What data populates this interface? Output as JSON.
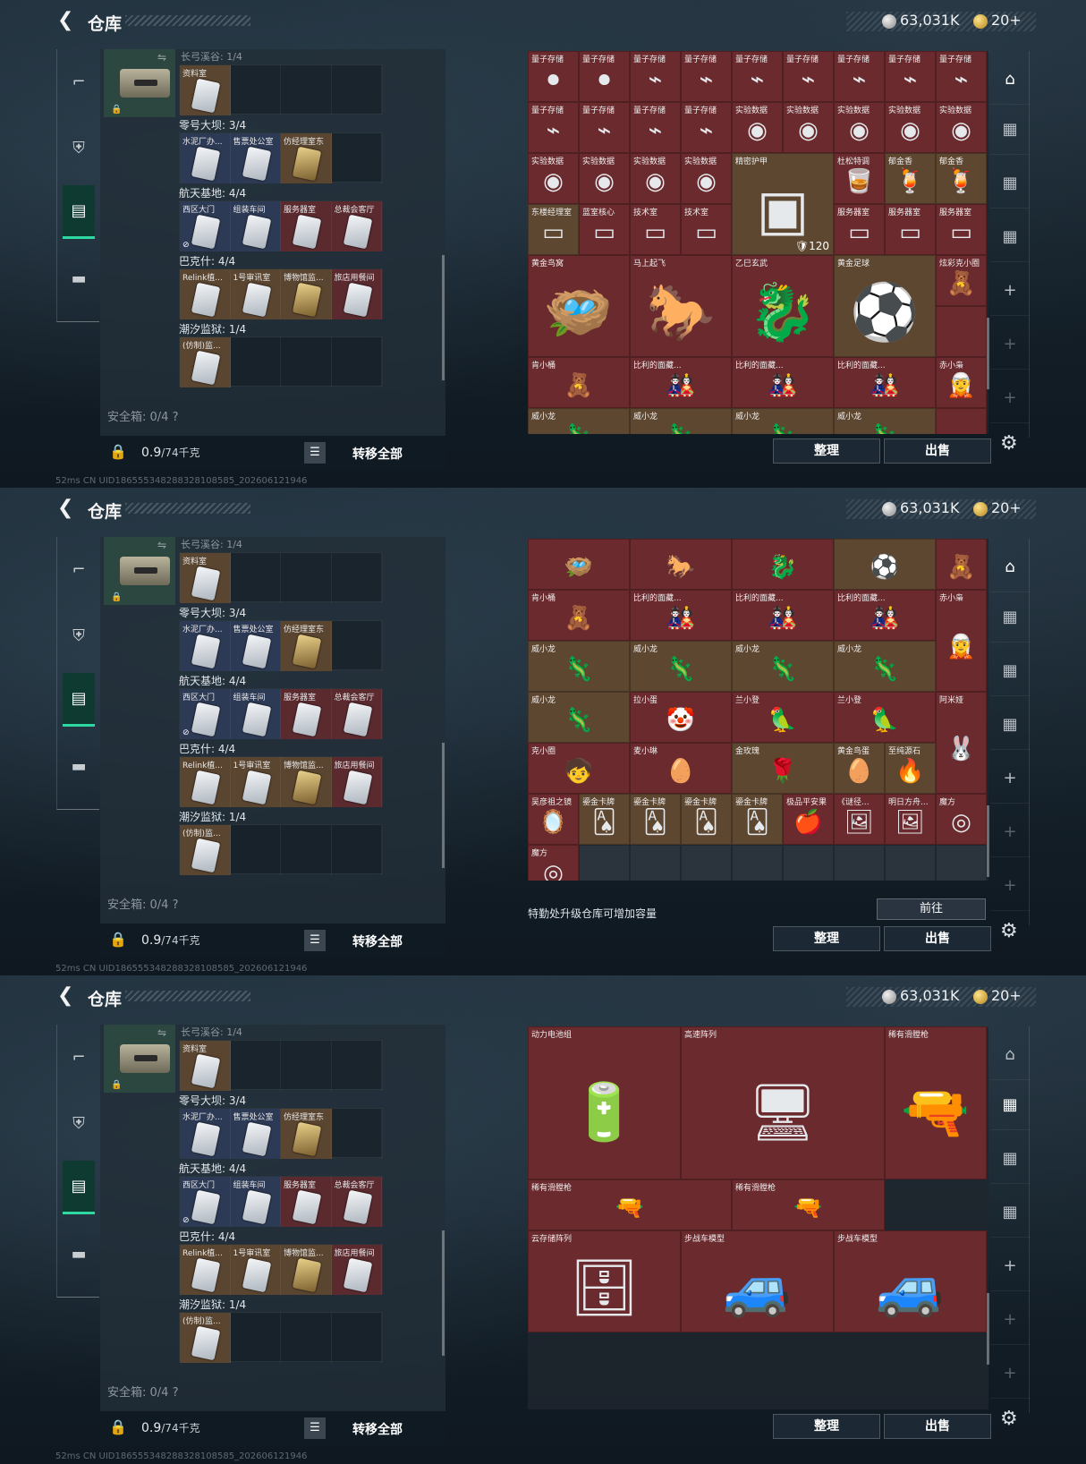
{
  "header": {
    "title": "仓库",
    "silver_amount": "63,031K",
    "gold_amount": "20+"
  },
  "left_list": {
    "faded_title": "长弓溪谷: 1/4",
    "first_slot_label": "资料室",
    "groups": [
      {
        "title": "零号大坝: 3/4",
        "slots": [
          {
            "label": "水泥厂办...",
            "tone": "blue"
          },
          {
            "label": "售票处公室",
            "tone": "blue"
          },
          {
            "label": "仿经理室东",
            "tone": "gold"
          },
          {
            "label": "",
            "tone": "empty"
          }
        ]
      },
      {
        "title": "航天基地: 4/4",
        "slots": [
          {
            "label": "西区大门",
            "tone": "blue"
          },
          {
            "label": "组装车间",
            "tone": "blue"
          },
          {
            "label": "服务器室",
            "tone": "red"
          },
          {
            "label": "总裁会客厅",
            "tone": "red"
          }
        ]
      },
      {
        "title": "巴克什: 4/4",
        "slots": [
          {
            "label": "Relink植...",
            "tone": "gold"
          },
          {
            "label": "1号审讯室",
            "tone": "gold"
          },
          {
            "label": "博物馆监...",
            "tone": "gold"
          },
          {
            "label": "旅店用餐间",
            "tone": "red"
          }
        ]
      },
      {
        "title": "潮汐监狱: 1/4",
        "slots": [
          {
            "label": "(仿制)监...",
            "tone": "gold"
          },
          {
            "label": "",
            "tone": "empty"
          },
          {
            "label": "",
            "tone": "empty"
          },
          {
            "label": "",
            "tone": "empty"
          }
        ]
      }
    ],
    "safe_label": "安全箱: 0/4 ?",
    "weight": "0.9",
    "weight_unit": "/74千克",
    "transfer_all": "转移全部"
  },
  "actions": {
    "organize": "整理",
    "sell": "出售",
    "go": "前往",
    "upgrade_note": "特勤处升级仓库可增加容量"
  },
  "panel1_cells": [
    {
      "label": "量子存储",
      "icon": "⏺",
      "tone": "red"
    },
    {
      "label": "量子存储",
      "icon": "⏺",
      "tone": "red"
    },
    {
      "label": "量子存储",
      "icon": "⌁",
      "tone": "red"
    },
    {
      "label": "量子存储",
      "icon": "⌁",
      "tone": "red"
    },
    {
      "label": "量子存储",
      "icon": "⌁",
      "tone": "red"
    },
    {
      "label": "量子存储",
      "icon": "⌁",
      "tone": "red"
    },
    {
      "label": "量子存储",
      "icon": "⌁",
      "tone": "red"
    },
    {
      "label": "量子存储",
      "icon": "⌁",
      "tone": "red"
    },
    {
      "label": "量子存储",
      "icon": "⌁",
      "tone": "red"
    },
    {
      "label": "量子存储",
      "icon": "⌁",
      "tone": "red"
    },
    {
      "label": "量子存储",
      "icon": "⌁",
      "tone": "red"
    },
    {
      "label": "量子存储",
      "icon": "⌁",
      "tone": "red"
    },
    {
      "label": "量子存储",
      "icon": "⌁",
      "tone": "red"
    },
    {
      "label": "实验数据",
      "icon": "◉",
      "tone": "red"
    },
    {
      "label": "实验数据",
      "icon": "◉",
      "tone": "red"
    },
    {
      "label": "实验数据",
      "icon": "◉",
      "tone": "red"
    },
    {
      "label": "实验数据",
      "icon": "◉",
      "tone": "red"
    },
    {
      "label": "实验数据",
      "icon": "◉",
      "tone": "red"
    },
    {
      "label": "实验数据",
      "icon": "◉",
      "tone": "red"
    },
    {
      "label": "实验数据",
      "icon": "◉",
      "tone": "red"
    },
    {
      "label": "实验数据",
      "icon": "◉",
      "tone": "red"
    },
    {
      "label": "实验数据",
      "icon": "◉",
      "tone": "red"
    },
    {
      "label": "精密护甲",
      "icon": "▣",
      "tone": "gold",
      "span": "w2 h2 big",
      "badge": "🛡120"
    },
    {
      "label": "杜松特调",
      "icon": "🥃",
      "tone": "red"
    },
    {
      "label": "郁金香",
      "icon": "🍹",
      "tone": "gold"
    },
    {
      "label": "郁金香",
      "icon": "🍹",
      "tone": "gold"
    },
    {
      "label": "东楼经理室",
      "icon": "▭",
      "tone": "gold"
    },
    {
      "label": "蓝室核心",
      "icon": "▭",
      "tone": "blue"
    },
    {
      "label": "技术室",
      "icon": "▭",
      "tone": "red"
    },
    {
      "label": "技术室",
      "icon": "▭",
      "tone": "red"
    },
    {
      "label": "服务器室",
      "icon": "▭",
      "tone": "red"
    },
    {
      "label": "服务器室",
      "icon": "▭",
      "tone": "red"
    },
    {
      "label": "服务器室",
      "icon": "▭",
      "tone": "red"
    },
    {
      "label": "黄金鸟窝",
      "icon": "🪺",
      "tone": "red",
      "span": "w2 h2 big"
    },
    {
      "label": "马上起飞",
      "icon": "🐎",
      "tone": "red",
      "span": "w2 h2 big"
    },
    {
      "label": "乙巳玄武",
      "icon": "🐉",
      "tone": "red",
      "span": "w2 h2 big"
    },
    {
      "label": "黄金足球",
      "icon": "⚽",
      "tone": "gold",
      "span": "w2 h2 big"
    },
    {
      "label": "炫彩克小圈",
      "icon": "🧸",
      "tone": "red"
    },
    {
      "label": "",
      "icon": "",
      "tone": "red"
    },
    {
      "label": "肯小桶",
      "icon": "🧸",
      "tone": "red",
      "span": "w2"
    },
    {
      "label": "比利的面藏...",
      "icon": "🎎",
      "tone": "red",
      "span": "w2"
    },
    {
      "label": "比利的面藏...",
      "icon": "🎎",
      "tone": "red",
      "span": "w2"
    },
    {
      "label": "比利的面藏...",
      "icon": "🎎",
      "tone": "red",
      "span": "w2"
    },
    {
      "label": "赤小枭",
      "icon": "🧝",
      "tone": "red"
    },
    {
      "label": "威小龙",
      "icon": "🦎",
      "tone": "gold",
      "span": "w2"
    },
    {
      "label": "威小龙",
      "icon": "🦎",
      "tone": "gold",
      "span": "w2"
    },
    {
      "label": "威小龙",
      "icon": "🦎",
      "tone": "gold",
      "span": "w2"
    },
    {
      "label": "威小龙",
      "icon": "🦎",
      "tone": "gold",
      "span": "w2"
    },
    {
      "label": "",
      "icon": "",
      "tone": "red"
    }
  ],
  "panel2_cells": [
    {
      "label": "",
      "icon": "🪺",
      "tone": "red",
      "span": "w2"
    },
    {
      "label": "",
      "icon": "🐎",
      "tone": "red",
      "span": "w2"
    },
    {
      "label": "",
      "icon": "🐉",
      "tone": "red",
      "span": "w2"
    },
    {
      "label": "",
      "icon": "⚽",
      "tone": "gold",
      "span": "w2"
    },
    {
      "label": "",
      "icon": "🧸",
      "tone": "red"
    },
    {
      "label": "肯小桶",
      "icon": "🧸",
      "tone": "red",
      "span": "w2"
    },
    {
      "label": "比利的面藏...",
      "icon": "🎎",
      "tone": "red",
      "span": "w2"
    },
    {
      "label": "比利的面藏...",
      "icon": "🎎",
      "tone": "red",
      "span": "w2"
    },
    {
      "label": "比利的面藏...",
      "icon": "🎎",
      "tone": "red",
      "span": "w2"
    },
    {
      "label": "赤小枭",
      "icon": "🧝",
      "tone": "red",
      "span": "h2"
    },
    {
      "label": "威小龙",
      "icon": "🦎",
      "tone": "gold",
      "span": "w2"
    },
    {
      "label": "威小龙",
      "icon": "🦎",
      "tone": "gold",
      "span": "w2"
    },
    {
      "label": "威小龙",
      "icon": "🦎",
      "tone": "gold",
      "span": "w2"
    },
    {
      "label": "威小龙",
      "icon": "🦎",
      "tone": "gold",
      "span": "w2"
    },
    {
      "label": "威小龙",
      "icon": "🦎",
      "tone": "gold",
      "span": "w2"
    },
    {
      "label": "拉小蛋",
      "icon": "🤡",
      "tone": "red",
      "span": "w2"
    },
    {
      "label": "兰小登",
      "icon": "🦜",
      "tone": "red",
      "span": "w2"
    },
    {
      "label": "兰小登",
      "icon": "🦜",
      "tone": "red",
      "span": "w2"
    },
    {
      "label": "阿米娅",
      "icon": "🐰",
      "tone": "red",
      "span": "h2"
    },
    {
      "label": "克小圈",
      "icon": "🧒",
      "tone": "red",
      "span": "w2"
    },
    {
      "label": "麦小琳",
      "icon": "🥚",
      "tone": "red",
      "span": "w2"
    },
    {
      "label": "金玫瑰",
      "icon": "🌹",
      "tone": "gold",
      "span": "w2"
    },
    {
      "label": "黄金鸟蛋",
      "icon": "🥚",
      "tone": "gold"
    },
    {
      "label": "至纯源石",
      "icon": "🔥",
      "tone": "gold"
    },
    {
      "label": "吴彦祖之镜",
      "icon": "🪞",
      "tone": "red"
    },
    {
      "label": "鎏金卡牌",
      "icon": "🂡",
      "tone": "gold"
    },
    {
      "label": "鎏金卡牌",
      "icon": "🂡",
      "tone": "gold"
    },
    {
      "label": "鎏金卡牌",
      "icon": "🂡",
      "tone": "gold"
    },
    {
      "label": "鎏金卡牌",
      "icon": "🂡",
      "tone": "gold"
    },
    {
      "label": "极品平安果",
      "icon": "🍎",
      "tone": "red"
    },
    {
      "label": "《谜径...",
      "icon": "🖼",
      "tone": "red"
    },
    {
      "label": "明日方舟...",
      "icon": "🖼",
      "tone": "red"
    },
    {
      "label": "魔方",
      "icon": "◎",
      "tone": "red"
    },
    {
      "label": "魔方",
      "icon": "◎",
      "tone": "red"
    },
    {
      "label": "",
      "icon": "",
      "tone": "empty"
    },
    {
      "label": "",
      "icon": "",
      "tone": "empty"
    },
    {
      "label": "",
      "icon": "",
      "tone": "empty"
    },
    {
      "label": "",
      "icon": "",
      "tone": "empty"
    },
    {
      "label": "",
      "icon": "",
      "tone": "empty"
    },
    {
      "label": "",
      "icon": "",
      "tone": "empty"
    },
    {
      "label": "",
      "icon": "",
      "tone": "empty"
    },
    {
      "label": "",
      "icon": "",
      "tone": "empty"
    }
  ],
  "panel3_cells": [
    {
      "label": "动力电池组",
      "icon": "🔋",
      "tone": "red",
      "span": "w3 h3 big"
    },
    {
      "label": "高速阵列",
      "icon": "🖥",
      "tone": "red",
      "span": "w4 h3 big"
    },
    {
      "label": "稀有滑膛枪",
      "icon": "🔫",
      "tone": "red",
      "span": "w2 h3 big"
    },
    {
      "label": "稀有滑膛枪",
      "icon": "🔫",
      "tone": "red",
      "span": "w4"
    },
    {
      "label": "稀有滑膛枪",
      "icon": "🔫",
      "tone": "red",
      "span": "w3"
    },
    {
      "label": "云存储阵列",
      "icon": "🗄",
      "tone": "red",
      "span": "w3 h2 big"
    },
    {
      "label": "步战车模型",
      "icon": "🚙",
      "tone": "red",
      "span": "w3 h2 big"
    },
    {
      "label": "步战车模型",
      "icon": "🚙",
      "tone": "red",
      "span": "w3 h2 big"
    }
  ],
  "status_bar": "52ms  CN UID186555348288328108585_202606121946"
}
